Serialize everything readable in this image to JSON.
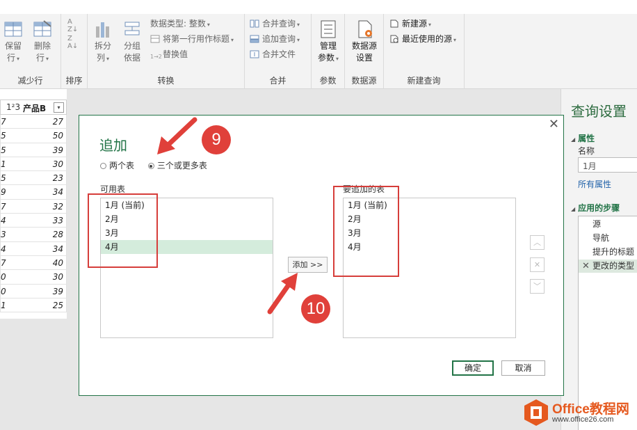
{
  "ribbon": {
    "groups": {
      "reduce_rows": "减少行",
      "sort": "排序",
      "transform": "转换",
      "combine": "合并",
      "parameters": "参数",
      "data_source": "数据源",
      "new_query": "新建查询"
    },
    "keep_rows": [
      "保留",
      "行"
    ],
    "remove_rows": [
      "删除",
      "行"
    ],
    "split_column": [
      "拆分",
      "列"
    ],
    "group_by": [
      "分组",
      "依据"
    ],
    "data_type": "数据类型: 整数",
    "use_first_row": "将第一行用作标题",
    "replace_values": "替换值",
    "merge_queries": "合并查询",
    "append_queries": "追加查询",
    "combine_files": "合并文件",
    "manage_params": [
      "管理",
      "参数"
    ],
    "data_source_settings": [
      "数据源",
      "设置"
    ],
    "new_source": "新建源",
    "recent_sources": "最近使用的源"
  },
  "grid": {
    "type_icon": "1²3",
    "column_header": "产品B",
    "rows": [
      {
        "left": "7",
        "value": "27"
      },
      {
        "left": "5",
        "value": "50"
      },
      {
        "left": "5",
        "value": "39"
      },
      {
        "left": "1",
        "value": "30"
      },
      {
        "left": "5",
        "value": "23"
      },
      {
        "left": "9",
        "value": "34"
      },
      {
        "left": "7",
        "value": "32"
      },
      {
        "left": "4",
        "value": "33"
      },
      {
        "left": "3",
        "value": "28"
      },
      {
        "left": "4",
        "value": "34"
      },
      {
        "left": "7",
        "value": "40"
      },
      {
        "left": "0",
        "value": "30"
      },
      {
        "left": "0",
        "value": "39"
      },
      {
        "left": "1",
        "value": "25"
      }
    ]
  },
  "panel": {
    "title": "查询设置",
    "properties": "属性",
    "name_label": "名称",
    "name_value": "1月",
    "all_properties": "所有属性",
    "applied_steps": "应用的步骤",
    "steps": [
      "源",
      "导航",
      "提升的标题",
      "更改的类型"
    ]
  },
  "dialog": {
    "title": "追加",
    "radio_two": "两个表",
    "radio_three": "三个或更多表",
    "available_label": "可用表",
    "append_label": "要追加的表",
    "available_tables": [
      "1月 (当前)",
      "2月",
      "3月",
      "4月"
    ],
    "append_tables": [
      "1月 (当前)",
      "2月",
      "3月",
      "4月"
    ],
    "add_button": "添加 >>",
    "ok": "确定",
    "cancel": "取消"
  },
  "annotations": {
    "step_a": "9",
    "step_b": "10"
  },
  "watermark": {
    "line1": "Office教程网",
    "line2": "www.office26.com"
  },
  "colors": {
    "accent": "#217346",
    "annotation": "#e0403a",
    "selected_row": "#d4ecdc"
  }
}
